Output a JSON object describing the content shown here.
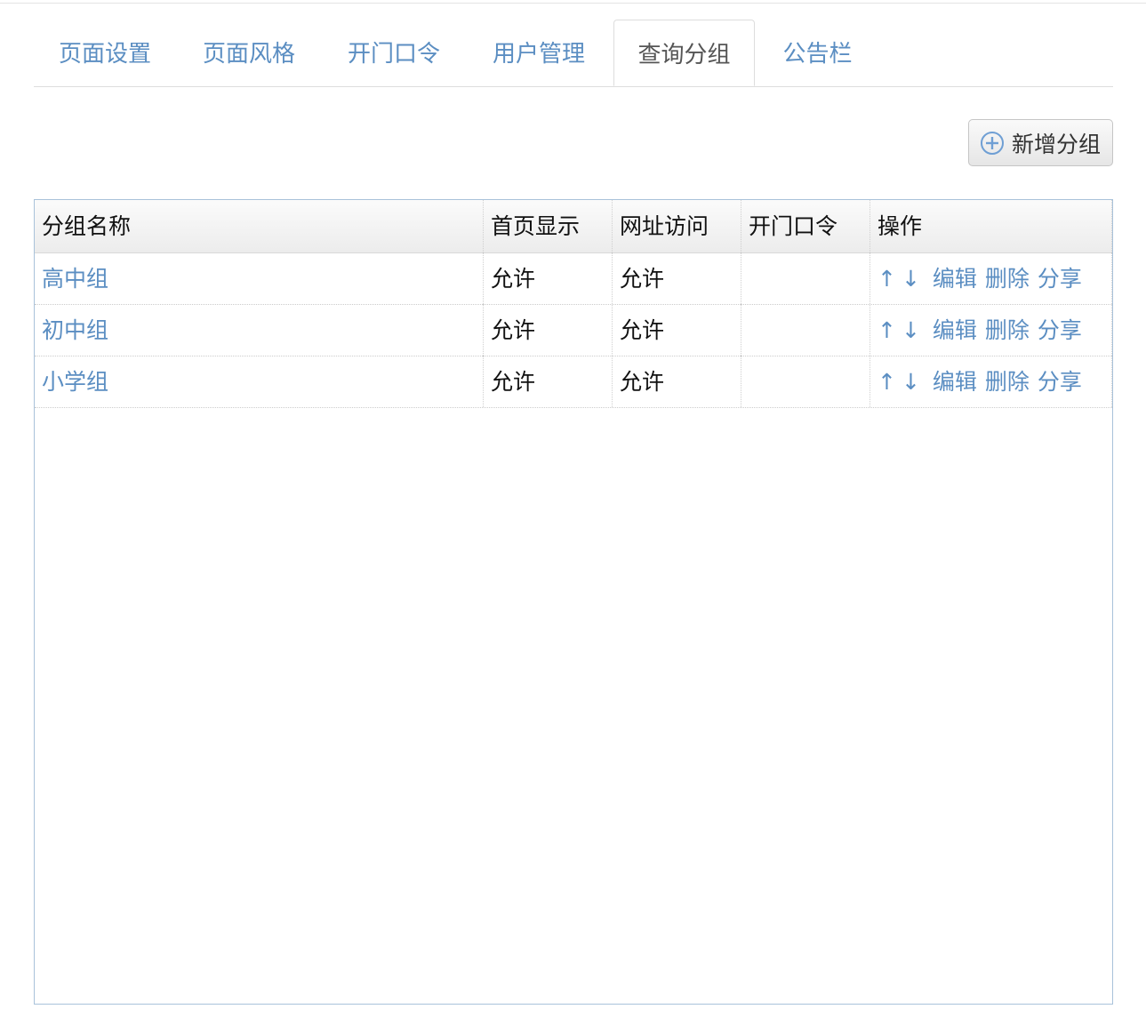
{
  "tabs": [
    {
      "label": "页面设置",
      "active": false
    },
    {
      "label": "页面风格",
      "active": false
    },
    {
      "label": "开门口令",
      "active": false
    },
    {
      "label": "用户管理",
      "active": false
    },
    {
      "label": "查询分组",
      "active": true
    },
    {
      "label": "公告栏",
      "active": false
    }
  ],
  "toolbar": {
    "add_group_label": "新增分组",
    "add_icon": "plus-circle-icon"
  },
  "table": {
    "columns": [
      "分组名称",
      "首页显示",
      "网址访问",
      "开门口令",
      "操作"
    ],
    "rows": [
      {
        "name": "高中组",
        "homepage": "允许",
        "url_access": "允许",
        "password": ""
      },
      {
        "name": "初中组",
        "homepage": "允许",
        "url_access": "允许",
        "password": ""
      },
      {
        "name": "小学组",
        "homepage": "允许",
        "url_access": "允许",
        "password": ""
      }
    ],
    "actions": {
      "up": "↑",
      "down": "↓",
      "edit": "编辑",
      "delete": "删除",
      "share": "分享"
    }
  },
  "colors": {
    "link": "#5b8ec2",
    "grid_border": "#a9c2da"
  }
}
